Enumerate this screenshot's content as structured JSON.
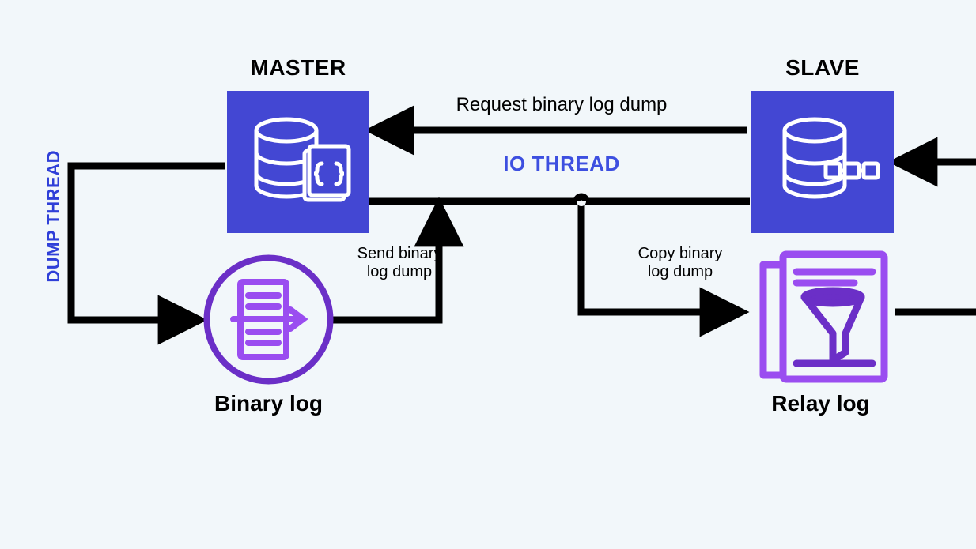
{
  "labels": {
    "master": "MASTER",
    "slave": "SLAVE",
    "binary_log": "Binary log",
    "relay_log": "Relay log",
    "dump_thread": "DUMP THREAD",
    "io_thread": "IO THREAD",
    "request_binlog_dump": "Request binary log dump",
    "send_binlog_dump_l1": "Send binary",
    "send_binlog_dump_l2": "log dump",
    "copy_binlog_dump_l1": "Copy binary",
    "copy_binlog_dump_l2": "log dump"
  },
  "colors": {
    "indigo": "#4347d3",
    "purple_light": "#9a4df0",
    "purple_dark": "#6b2fc7",
    "page_bg": "#f2f7fa"
  }
}
